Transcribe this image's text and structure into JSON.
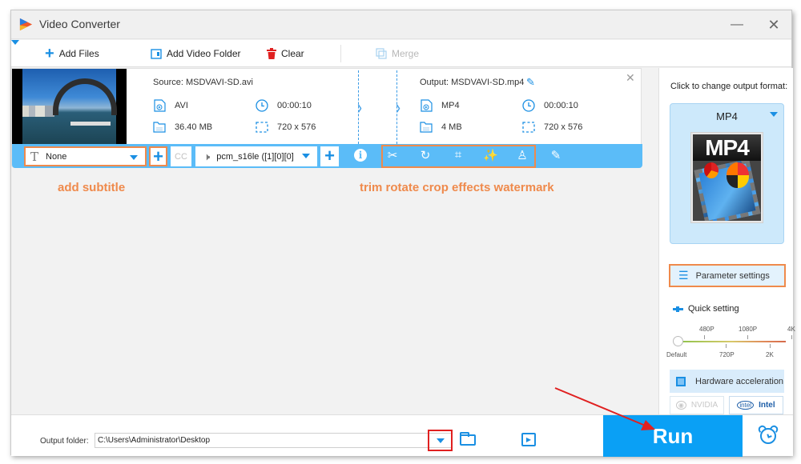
{
  "window": {
    "title": "Video Converter",
    "minimize_glyph": "—",
    "close_glyph": "✕"
  },
  "toolbar": {
    "add_files": "Add Files",
    "add_video_folder": "Add Video Folder",
    "clear": "Clear",
    "merge": "Merge"
  },
  "file": {
    "source_label": "Source: MSDVAVI-SD.avi",
    "output_label": "Output: MSDVAVI-SD.mp4",
    "source": {
      "format": "AVI",
      "duration": "00:00:10",
      "size": "36.40 MB",
      "resolution": "720 x 576"
    },
    "output": {
      "format": "MP4",
      "duration": "00:00:10",
      "size": "4 MB",
      "resolution": "720 x 576"
    },
    "subtitle_value": "None",
    "audio_track_value": "pcm_s16le ([1][0][0]",
    "cc_label": "CC"
  },
  "annotations": {
    "subtitle": "add subtitle",
    "tools": "trim rotate crop effects watermark"
  },
  "tools": [
    {
      "name": "trim",
      "glyph": "✂"
    },
    {
      "name": "rotate",
      "glyph": "↻"
    },
    {
      "name": "crop",
      "glyph": "⌗"
    },
    {
      "name": "effects",
      "glyph": "✨"
    },
    {
      "name": "watermark",
      "glyph": "♙"
    },
    {
      "name": "edit-subtitle",
      "glyph": "✎"
    }
  ],
  "right_panel": {
    "format_prompt": "Click to change output format:",
    "format_name": "MP4",
    "format_image_text": "MP4",
    "parameter_settings": "Parameter settings",
    "quick_setting": "Quick setting",
    "slider_top_labels": [
      "480P",
      "1080P",
      "4K"
    ],
    "slider_bottom_labels": [
      "Default",
      "720P",
      "2K"
    ],
    "slider_value": "Default",
    "hardware_acceleration": "Hardware acceleration",
    "gpu_nvidia": "NVIDIA",
    "gpu_intel": "Intel",
    "intel_logo": "intel"
  },
  "bottom": {
    "output_folder_label": "Output folder:",
    "output_folder_value": "C:\\Users\\Administrator\\Desktop",
    "run": "Run"
  },
  "colors": {
    "accent_blue": "#1a8fe3",
    "strip_blue": "#5bbcf8",
    "run_blue": "#0aa0f5",
    "annotation_orange": "#ef8a4c",
    "highlight_red": "#e02020"
  }
}
